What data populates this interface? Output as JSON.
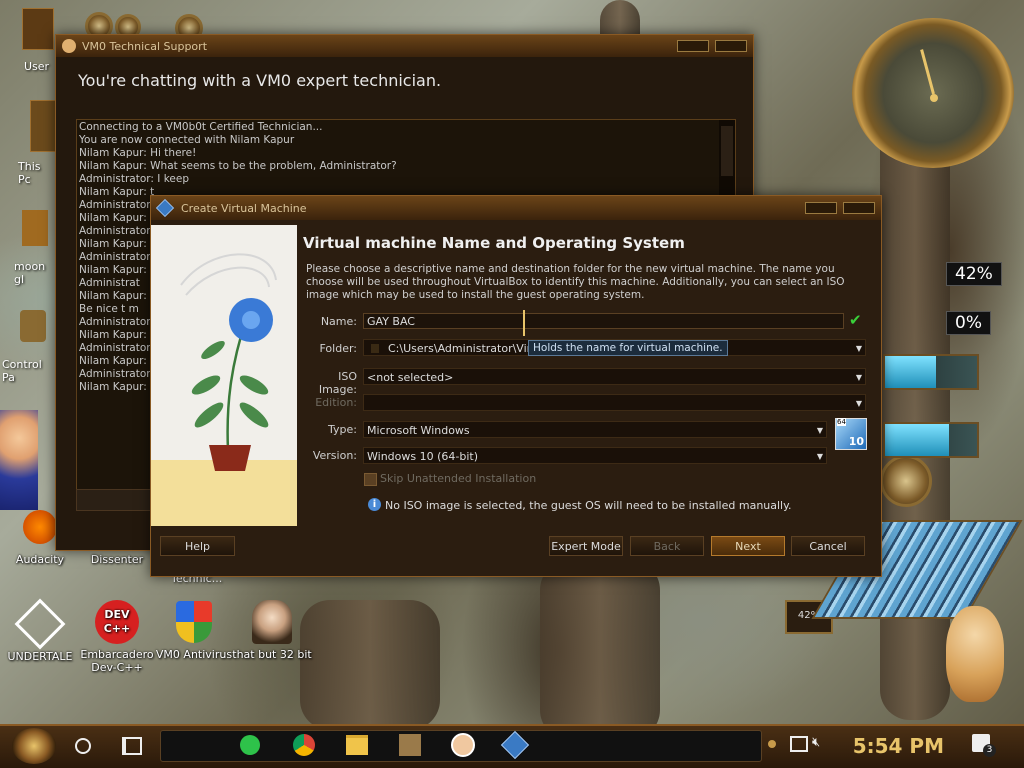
{
  "desktop": {
    "icons": [
      {
        "label": "User"
      },
      {
        "label": "This Pc"
      },
      {
        "label": "moon gl"
      },
      {
        "label": "Control Pa"
      },
      {
        "label": "Audacity"
      },
      {
        "label": "Dissenter"
      },
      {
        "label": "UNDERTALE"
      },
      {
        "label": "Embarcadero Dev-C++"
      },
      {
        "label": "VM0 Antivirus"
      },
      {
        "label": "that but 32 bit"
      }
    ],
    "partial_label": "Technic..."
  },
  "widgets": {
    "cpu_percent": "42%",
    "mem_percent": "0%",
    "meter_label": "42%"
  },
  "chat_window": {
    "title": "VM0 Technical Support",
    "heading": "You're chatting with a VM0 expert technician.",
    "log": [
      "Connecting to a VM0b0t Certified Technician...",
      "You are now connected with Nilam Kapur",
      "Nilam Kapur: Hi there!",
      "Nilam Kapur: What seems to be the problem, Administrator?",
      "Administrator: I keep",
      "Nilam Kapur: t",
      "Administrator:",
      "Nilam Kapur: s",
      "Administrator:",
      "Nilam Kapur: i",
      "Administrator:",
      "Nilam Kapur: ",
      "Administrat",
      "Nilam Kapur: I",
      "Be nice t m",
      "Administrator:",
      "Nilam Kapur: i",
      "Administrator:",
      "Nilam Kapur: s",
      "Administrator:",
      "Nilam Kapur: t"
    ]
  },
  "vbox": {
    "title": "Create Virtual Machine",
    "page_title": "Virtual machine Name and Operating System",
    "description": "Please choose a descriptive name and destination folder for the new virtual machine. The name you choose will be used throughout VirtualBox to identify this machine. Additionally, you can select an ISO image which may be used to install the guest operating system.",
    "labels": {
      "name": "Name:",
      "folder": "Folder:",
      "iso": "ISO Image:",
      "edition": "Edition:",
      "type": "Type:",
      "version": "Version:"
    },
    "values": {
      "name": "GAY BAC",
      "folder": "C:\\Users\\Administrator\\Virtu",
      "iso": "<not selected>",
      "edition": "",
      "type": "Microsoft Windows",
      "version": "Windows 10 (64-bit)"
    },
    "tooltip": "Holds the name for virtual machine.",
    "unattended": "Skip Unattended Installation",
    "info": "No ISO image is selected, the guest OS will need to be installed manually.",
    "os_badge": {
      "bits": "64",
      "version": "10"
    },
    "buttons": {
      "help": "Help",
      "expert": "Expert Mode",
      "back": "Back",
      "next": "Next",
      "cancel": "Cancel"
    }
  },
  "taskbar": {
    "time": "5:54 PM",
    "notifications": "3"
  }
}
